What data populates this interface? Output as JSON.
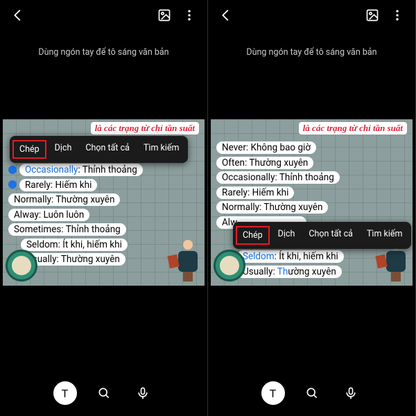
{
  "instruction": "Dùng ngón tay để tô sáng văn bản",
  "header_red": "là các trạng từ chỉ tần suất",
  "lines": [
    {
      "en": "Never",
      "vi": "Không bao giờ"
    },
    {
      "en": "Often",
      "vi": "Thường xuyên"
    },
    {
      "en": "Occasionally",
      "vi": "Thỉnh thoảng"
    },
    {
      "en": "Rarely",
      "vi": "Hiếm khi"
    },
    {
      "en": "Normally",
      "vi": "Thường xuyên"
    },
    {
      "en": "Alway",
      "vi": "Luôn luôn"
    },
    {
      "en": "Sometimes",
      "vi": "Thỉnh thoảng"
    },
    {
      "en": "Seldom",
      "vi": "Ít khi, hiếm khi"
    },
    {
      "en": "Usually",
      "vi": "Thường xuyên"
    }
  ],
  "ctx": {
    "copy": "Chép",
    "translate": "Dịch",
    "select_all": "Chọn tất cả",
    "search": "Tìm kiếm"
  },
  "left_sel": {
    "highlighted_index": 2,
    "highlight_text": "Occasionally",
    "menu_covers": [
      0,
      1
    ]
  },
  "right_sel": {
    "highlighted_index": 7,
    "highlight_text": "Seldom",
    "menu_covers": [
      5,
      6
    ]
  },
  "bottom_T": "T"
}
